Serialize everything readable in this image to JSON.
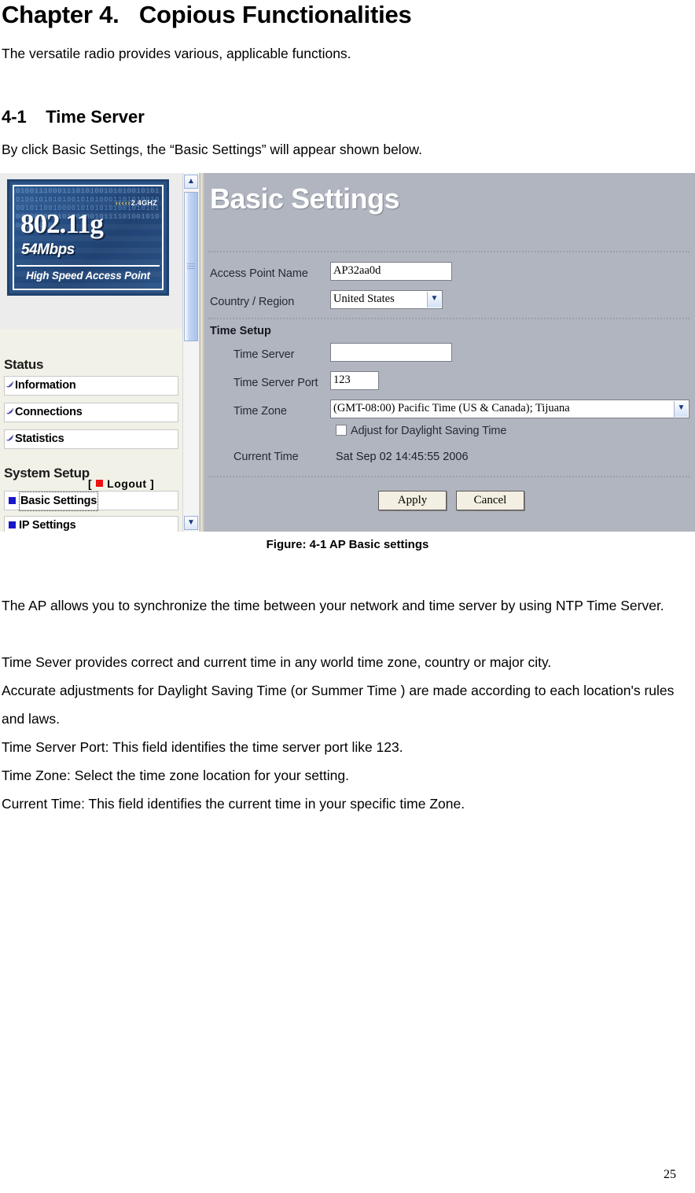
{
  "document": {
    "chapter_title": "Chapter 4.   Copious Functionalities",
    "intro_line": "The versatile radio provides various, applicable functions.",
    "section_heading": "4-1    Time Server",
    "lead_line": "By click Basic Settings, the “Basic Settings” will appear shown below.",
    "figure_caption": "Figure: 4-1 AP Basic settings",
    "page_number": "25",
    "paragraphs": [
      "The AP allows you to synchronize the time between your network and time server by using NTP Time Server.",
      "Time Sever provides correct and current time in any world time zone, country or major city.",
      "Accurate adjustments for Daylight Saving Time (or Summer Time ) are made according to each location's rules and laws.",
      "Time Server Port: This field identifies the time server port like 123.",
      "Time Zone: Select the time zone location for your setting.",
      "Current Time: This field identifies the current time in your specific time Zone."
    ]
  },
  "screenshot": {
    "logo": {
      "frequency": "2.4GHZ",
      "chevrons": "‹‹‹‹‹",
      "standard": "802.11g",
      "speed": "54Mbps",
      "tagline": "High Speed Access Point",
      "binary_fill": "0100111000111010100101010010101010010101010010101000110101001000101100100001010101010010101010010010101010010010111101001010001110101"
    },
    "logout": {
      "open_bracket": "[",
      "label": "Logout",
      "close_bracket": "]"
    },
    "sidebar": {
      "groups": [
        {
          "title": "Status",
          "items": [
            {
              "label": "Information",
              "icon": "wireless-wave-icon",
              "active": false
            },
            {
              "label": "Connections",
              "icon": "wireless-wave-icon",
              "active": false
            },
            {
              "label": "Statistics",
              "icon": "wireless-wave-icon",
              "active": false
            }
          ]
        },
        {
          "title": "System Setup",
          "items": [
            {
              "label": "Basic Settings",
              "icon": "blue-square-icon",
              "active": true
            },
            {
              "label": "IP Settings",
              "icon": "blue-square-icon",
              "active": false
            }
          ]
        }
      ]
    },
    "scrollbar": {
      "up_arrow": "▲",
      "down_arrow": "▼"
    },
    "panel": {
      "title": "Basic Settings",
      "fields": [
        {
          "label": "Access Point Name",
          "value": "AP32aa0d",
          "type": "text"
        },
        {
          "label": "Country / Region",
          "value": "United States",
          "type": "select"
        }
      ],
      "time_setup": {
        "section_label": "Time Setup",
        "time_server": {
          "label": "Time Server",
          "value": ""
        },
        "time_server_port": {
          "label": "Time Server Port",
          "value": "123"
        },
        "time_zone": {
          "label": "Time Zone",
          "value": "(GMT-08:00) Pacific Time (US & Canada); Tijuana"
        },
        "daylight_saving": {
          "label": "Adjust for Daylight Saving Time",
          "checked": false
        },
        "current_time": {
          "label": "Current Time",
          "value": "Sat Sep 02 14:45:55 2006"
        }
      },
      "buttons": {
        "apply": "Apply",
        "cancel": "Cancel"
      }
    },
    "colors": {
      "panel_bg": "#b1b5bf",
      "logo_blue": "#2a5285",
      "accent_blue": "#1818c8",
      "logout_red": "#ee1111",
      "sidebar_bg": "#f1f1e8"
    }
  }
}
